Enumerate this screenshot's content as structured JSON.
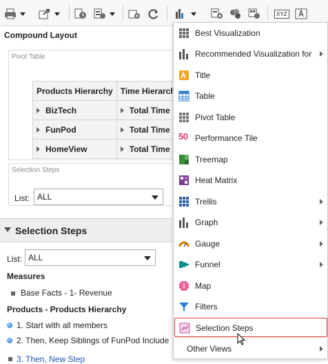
{
  "toolbar": {
    "icons": [
      "print-icon",
      "export-icon",
      "schedule-icon",
      "sort-icon",
      "properties-icon",
      "refresh-icon",
      "new-view-icon",
      "add-column-icon",
      "add-group-icon",
      "add-calc-icon",
      "xyz-icon",
      "text-edit-icon"
    ],
    "xyz_label": "XYZ"
  },
  "compound": {
    "title": "Compound Layout",
    "pivot": {
      "label": "Pivot Table",
      "headers": [
        "Products Hierarchy",
        "Time Hierarch"
      ],
      "rows": [
        {
          "product": "BizTech",
          "time": "Total Time"
        },
        {
          "product": "FunPod",
          "time": "Total Time"
        },
        {
          "product": "HomeView",
          "time": "Total Time"
        }
      ]
    },
    "selection_view": {
      "label": "Selection Steps",
      "list_label": "List:",
      "list_value": "ALL"
    }
  },
  "steps_pane": {
    "title": "Selection Steps",
    "list_label": "List:",
    "list_value": "ALL",
    "measures_heading": "Measures",
    "measure_item": "Base Facts - 1- Revenue",
    "products_heading": "Products - Products Hierarchy",
    "steps": [
      "1. Start with all members",
      "2. Then, Keep Siblings of FunPod Include",
      "3. Then, New Step"
    ]
  },
  "menu": {
    "items": [
      {
        "label": "Best Visualization",
        "icon": "grid-icon",
        "submenu": false
      },
      {
        "label": "Recommended Visualization for",
        "icon": "bar-chart-icon",
        "submenu": true
      },
      {
        "label": "Title",
        "icon": "title-icon",
        "submenu": false
      },
      {
        "label": "Table",
        "icon": "table-icon",
        "submenu": false
      },
      {
        "label": "Pivot Table",
        "icon": "pivot-table-icon",
        "submenu": false
      },
      {
        "label": "Performance Tile",
        "icon": "performance-tile-icon",
        "submenu": false,
        "tile_text": "50"
      },
      {
        "label": "Treemap",
        "icon": "treemap-icon",
        "submenu": false
      },
      {
        "label": "Heat Matrix",
        "icon": "heat-matrix-icon",
        "submenu": false
      },
      {
        "label": "Trellis",
        "icon": "trellis-icon",
        "submenu": true
      },
      {
        "label": "Graph",
        "icon": "graph-icon",
        "submenu": true
      },
      {
        "label": "Gauge",
        "icon": "gauge-icon",
        "submenu": true
      },
      {
        "label": "Funnel",
        "icon": "funnel-icon",
        "submenu": true
      },
      {
        "label": "Map",
        "icon": "map-icon",
        "submenu": false
      },
      {
        "label": "Filters",
        "icon": "filter-icon",
        "submenu": false
      },
      {
        "label": "Selection Steps",
        "icon": "selection-steps-icon",
        "submenu": false,
        "highlighted": true
      },
      {
        "label": "Other Views",
        "icon": "",
        "submenu": true
      }
    ]
  },
  "colors": {
    "accent": "#1f6fcc",
    "highlight_border": "#d9362e",
    "treemap": "#3a8a3a",
    "heat": "#7a3a9a",
    "funnel": "#0e8d8f",
    "gauge": "#e07b00",
    "map": "#e8367c"
  }
}
